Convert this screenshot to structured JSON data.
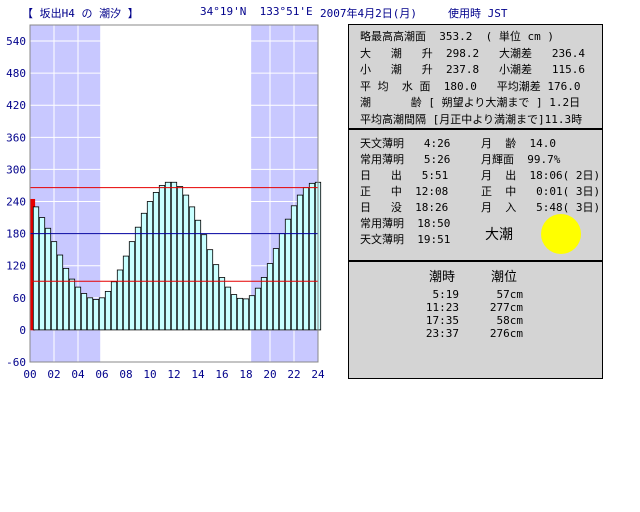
{
  "header": {
    "location": "【 坂出H4 の 潮汐 】",
    "coords": "34°19'N  133°51'E",
    "date": "2007年4月2日(月)",
    "timezone": "使用時 JST"
  },
  "chart_data": {
    "type": "bar",
    "x": [
      0.0,
      0.5,
      1.0,
      1.5,
      2.0,
      2.5,
      3.0,
      3.5,
      4.0,
      4.5,
      5.0,
      5.5,
      6.0,
      6.5,
      7.0,
      7.5,
      8.0,
      8.5,
      9.0,
      9.5,
      10.0,
      10.5,
      11.0,
      11.5,
      12.0,
      12.5,
      13.0,
      13.5,
      14.0,
      14.5,
      15.0,
      15.5,
      16.0,
      16.5,
      17.0,
      17.5,
      18.0,
      18.5,
      19.0,
      19.5,
      20.0,
      20.5,
      21.0,
      21.5,
      22.0,
      22.5,
      23.0,
      23.5,
      24.0
    ],
    "values": [
      244,
      230,
      210,
      190,
      165,
      140,
      115,
      95,
      80,
      68,
      60,
      57,
      60,
      72,
      90,
      112,
      138,
      165,
      192,
      218,
      240,
      257,
      270,
      276,
      276,
      268,
      252,
      230,
      205,
      178,
      150,
      122,
      98,
      80,
      66,
      59,
      58,
      64,
      78,
      98,
      124,
      152,
      180,
      207,
      232,
      252,
      266,
      274,
      276
    ],
    "bar_colors": {
      "default": "#c8ffff",
      "current": "#e60000",
      "outline": "#000000"
    },
    "x_ticks": [
      "00",
      "02",
      "04",
      "06",
      "08",
      "10",
      "12",
      "14",
      "16",
      "18",
      "20",
      "22",
      "24"
    ],
    "y_ticks": [
      -60,
      0,
      60,
      120,
      180,
      240,
      300,
      360,
      420,
      480,
      540
    ],
    "xlim": [
      0,
      24
    ],
    "ylim": [
      -60,
      570
    ],
    "night_bands": [
      [
        0,
        5.85
      ],
      [
        18.43,
        24
      ]
    ],
    "night_color": "#c8c8ff",
    "reference_lines": [
      {
        "value": 266,
        "color": "#e60000"
      },
      {
        "value": 180,
        "color": "#0000a0"
      },
      {
        "value": 91,
        "color": "#e60000"
      }
    ],
    "grid": true
  },
  "panel1": {
    "rows": [
      "略最高高潮面  353.2  ( 単位 cm )",
      "大   潮   升  298.2   大潮差   236.4",
      "小   潮   升  237.8   小潮差   115.6",
      "平 均  水 面  180.0   平均潮差 176.0",
      "潮      齢 [ 朔望より大潮まで ] 1.2日",
      "平均高潮間隔 [月正中より満潮まで]11.3時"
    ]
  },
  "panel2": {
    "left_rows": [
      "天文薄明   4:26",
      "常用薄明   5:26",
      "日   出   5:51",
      "正   中  12:08",
      "日   没  18:26",
      "常用薄明  18:50",
      "天文薄明  19:51"
    ],
    "right_rows": [
      "月  齢  14.0",
      "月輝面  99.7%",
      "月  出  18:06( 2日)",
      "正  中   0:01( 3日)",
      "月  入   5:48( 3日)"
    ],
    "tide_type": "大潮",
    "moon_color": "#ffff00"
  },
  "panel3": {
    "col_time": "潮時",
    "col_level": "潮位",
    "entries": [
      {
        "time": "5:19",
        "level": "57cm"
      },
      {
        "time": "11:23",
        "level": "277cm"
      },
      {
        "time": "17:35",
        "level": "58cm"
      },
      {
        "time": "23:37",
        "level": "276cm"
      }
    ]
  }
}
